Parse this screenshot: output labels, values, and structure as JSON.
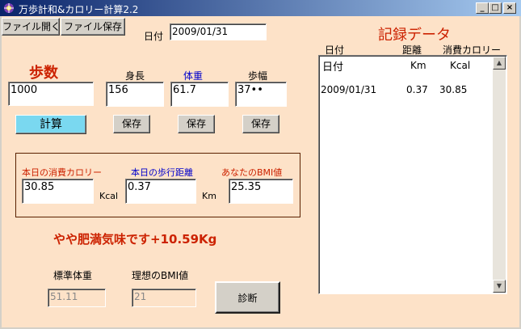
{
  "window": {
    "title": "万歩計和&カロリー計算2.2"
  },
  "toolbar": {
    "open_label": "ファイル開く",
    "save_label": "ファイル保存"
  },
  "date": {
    "label": "日付",
    "value": "2009/01/31"
  },
  "steps": {
    "label": "歩数",
    "value": "1000",
    "calc_label": "計算"
  },
  "height": {
    "label": "身長",
    "value": "156",
    "save_label": "保存"
  },
  "weight": {
    "label": "体重",
    "value": "61.7",
    "save_label": "保存"
  },
  "stride": {
    "label": "歩幅",
    "value": "37••",
    "save_label": "保存"
  },
  "results": {
    "calorie_label": "本日の消費カロリー",
    "calorie_value": "30.85",
    "calorie_unit": "Kcal",
    "distance_label": "本日の歩行距離",
    "distance_value": "0.37",
    "distance_unit": "Km",
    "bmi_label": "あなたのBMI値",
    "bmi_value": "25.35"
  },
  "message": "やや肥満気味です+10.59Kg",
  "standard": {
    "weight_label": "標準体重",
    "weight_value": "51.11",
    "bmi_label": "理想のBMI値",
    "bmi_value": "21",
    "diagnose_label": "診断"
  },
  "records": {
    "title": "記録データ",
    "headers": [
      "日付",
      "距離",
      "消費カロリー"
    ],
    "list_headers": [
      "日付",
      "Km",
      "Kcal"
    ],
    "rows": [
      [
        "2009/01/31",
        "0.37",
        "30.85"
      ]
    ]
  },
  "colors": {
    "background": "#fde2c8",
    "title_red": "#cc2200",
    "label_blue": "#0000cc"
  }
}
